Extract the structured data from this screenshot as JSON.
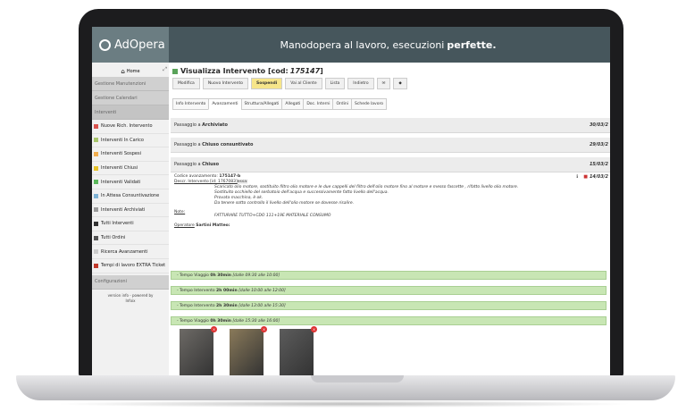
{
  "header": {
    "logo": "AdOpera",
    "tagline_pre": "Manodopera",
    "tagline_mid": "al lavoro, esecuzioni",
    "tagline_bold": "perfette."
  },
  "sidebar": {
    "home": "Home",
    "groups": {
      "manutenzioni": "Gestione Manutenzioni",
      "calendari": "Gestione Calendari",
      "interventi": "Interventi",
      "configurazioni": "Configurazioni"
    },
    "items": [
      {
        "label": "Nuove Rich. Intervento",
        "color": "#d9534f"
      },
      {
        "label": "Interventi In Carico",
        "color": "#a8c66c"
      },
      {
        "label": "Interventi Sospesi",
        "color": "#f0ad4e"
      },
      {
        "label": "Interventi Chiusi",
        "color": "#e6c229"
      },
      {
        "label": "Interventi Validati",
        "color": "#5cb85c"
      },
      {
        "label": "In Attesa Consuntivazione",
        "color": "#7fb3d5"
      },
      {
        "label": "Interventi Archiviati",
        "color": "#9b9b9b"
      },
      {
        "label": "Tutti Interventi",
        "color": "#333333"
      },
      {
        "label": "Tutti Ordini",
        "color": "#555555"
      },
      {
        "label": "Ricerca Avanzamenti",
        "color": "#cccccc"
      },
      {
        "label": "Tempi di lavoro EXTRA Ticket",
        "color": "#c0392b"
      }
    ],
    "footer_line1": "version info - powered by",
    "footer_line2": "Infoix"
  },
  "main": {
    "title_prefix": "Visualizza Intervento [cod:",
    "title_code": "175147",
    "title_suffix": "]",
    "toolbar": [
      {
        "label": "Modifica",
        "highlight": false
      },
      {
        "label": "Nuovo Intervento",
        "highlight": false
      },
      {
        "label": "Sospendi",
        "highlight": true
      },
      {
        "label": "Vai al Cliente",
        "highlight": false
      },
      {
        "label": "Lista",
        "highlight": false
      },
      {
        "label": "Indietro",
        "highlight": false
      }
    ],
    "tabs": [
      {
        "label": "Info Intervento",
        "active": false
      },
      {
        "label": "Avanzamenti",
        "active": true
      },
      {
        "label": "Struttura/Allegati",
        "active": false
      },
      {
        "label": "Allegati",
        "active": false
      },
      {
        "label": "Doc. Interni",
        "active": false
      },
      {
        "label": "Ordini",
        "active": false
      },
      {
        "label": "Schede lavoro",
        "active": false
      }
    ],
    "passages": [
      {
        "label": "Passaggio a",
        "state": "Archiviato",
        "date": "30/03/2"
      },
      {
        "label": "Passaggio a",
        "state": "Chiuso consuntivato",
        "date": "29/03/2"
      },
      {
        "label": "Passaggio a",
        "state": "Chiuso",
        "date": "15/03/2"
      }
    ],
    "detail": {
      "code_label": "Codice avanzamento:",
      "code": "175147-b",
      "desc_label": "Descr. Intervento [id: 1767083]",
      "desc_suffix": "essa:",
      "desc_lines": [
        "Scaricato olio motore, sostituito filtro olio motore e le due cappelli del filtro dell'olio motore fino al motore e messo fascette , rifatto livello olio motore.",
        "Sostituito occhiello del serbatoio dell'acqua e successivamente fatto livello dell'acqua.",
        "Provata macchina, è ok.",
        "Da tenere sotto controllo il livello dell'olio motore se dovesse risalire."
      ],
      "note_label": "Note:",
      "note_text": "FATTURARE TUTTO+CDO 111+19E MATERIALE CONSUMO",
      "operator_label": "Operatore",
      "operator": "Sartini Matteo:",
      "pdf_date": "14/03/2"
    },
    "times": [
      {
        "type": "- Tempo Viaggio",
        "dur": "0h 30min",
        "range": "[dalle 09:30 alle 10:00]"
      },
      {
        "type": "- Tempo Intervento",
        "dur": "2h 00min",
        "range": "[dalle 10:00 alle 12:00]"
      },
      {
        "type": "- Tempo Intervento",
        "dur": "2h 30min",
        "range": "[dalle 13:00 alle 15:30]"
      },
      {
        "type": "- Tempo Viaggio",
        "dur": "0h 30min",
        "range": "[dalle 15:30 alle 16:00]"
      }
    ],
    "photos": [
      {
        "name": "photo-1",
        "color": "#6d6a66"
      },
      {
        "name": "photo-2",
        "color": "#8a7a5a"
      },
      {
        "name": "photo-3",
        "color": "#5c5c5c"
      }
    ]
  }
}
